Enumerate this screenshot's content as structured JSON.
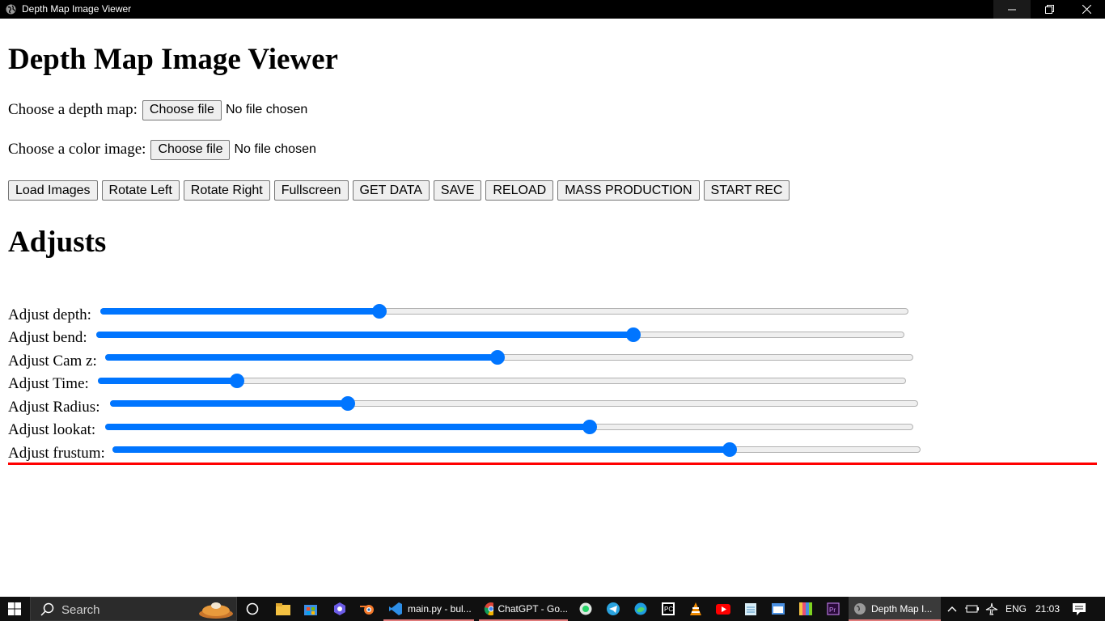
{
  "window": {
    "title": "Depth Map Image Viewer",
    "controls": {
      "minimize": "minimize-icon",
      "maximize": "restore-icon",
      "close": "close-icon"
    }
  },
  "page": {
    "heading": "Depth Map Image Viewer",
    "depth_map": {
      "label": "Choose a depth map:",
      "button": "Choose file",
      "status": "No file chosen"
    },
    "color_image": {
      "label": "Choose a color image:",
      "button": "Choose file",
      "status": "No file chosen"
    },
    "buttons": [
      "Load Images",
      "Rotate Left",
      "Rotate Right",
      "Fullscreen",
      "GET DATA",
      "SAVE",
      "RELOAD",
      "MASS PRODUCTION",
      "START REC"
    ],
    "adjusts_heading": "Adjusts",
    "sliders": [
      {
        "label": "Adjust depth:",
        "value": 0.345
      },
      {
        "label": "Adjust bend:",
        "value": 0.665
      },
      {
        "label": "Adjust Cam z:",
        "value": 0.485
      },
      {
        "label": "Adjust Time:",
        "value": 0.172
      },
      {
        "label": "Adjust Radius:",
        "value": 0.294
      },
      {
        "label": "Adjust lookat:",
        "value": 0.6
      },
      {
        "label": "Adjust frustum:",
        "value": 0.764
      }
    ],
    "accent_color": "#0075ff",
    "divider_color": "#ff0000"
  },
  "taskbar": {
    "search_placeholder": "Search",
    "apps": [
      {
        "label": "main.py - bul...",
        "icon": "vscode-icon"
      },
      {
        "label": "ChatGPT - Go...",
        "icon": "chrome-icon"
      },
      {
        "label": "Depth Map I...",
        "icon": "browser-icon"
      }
    ],
    "language": "ENG",
    "time": "21:03"
  }
}
